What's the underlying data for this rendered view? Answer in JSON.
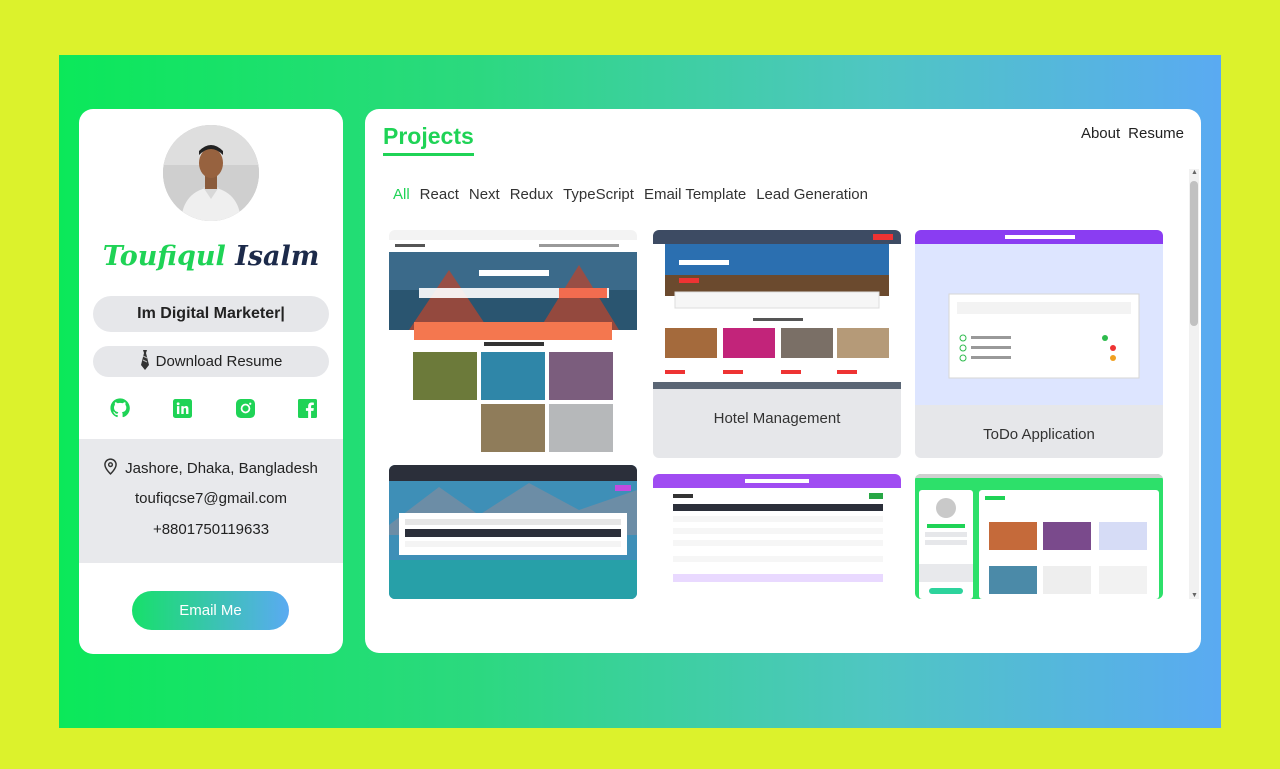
{
  "profile": {
    "first_name": "Toufiqul",
    "last_name": "Isalm",
    "role": "Im Digital Marketer|",
    "download_label": "Download Resume",
    "socials": [
      "github-icon",
      "linkedin-icon",
      "instagram-icon",
      "facebook-icon"
    ],
    "location": "Jashore, Dhaka, Bangladesh",
    "email": "toufiqcse7@gmail.com",
    "phone": "+8801750119633",
    "email_button": "Email Me"
  },
  "panel": {
    "title": "Projects",
    "nav": [
      "About",
      "Resume"
    ],
    "filters": [
      "All",
      "React",
      "Next",
      "Redux",
      "TypeScript",
      "Email Template",
      "Lead Generation"
    ],
    "active_filter": "All"
  },
  "projects": [
    {
      "label": ""
    },
    {
      "label": "Hotel Management"
    },
    {
      "label": "ToDo Application"
    },
    {
      "label": ""
    },
    {
      "label": ""
    },
    {
      "label": ""
    }
  ],
  "colors": {
    "page_bg": "#dcf22c",
    "accent": "#1fd356",
    "gradient_end": "#5aaaf2"
  }
}
